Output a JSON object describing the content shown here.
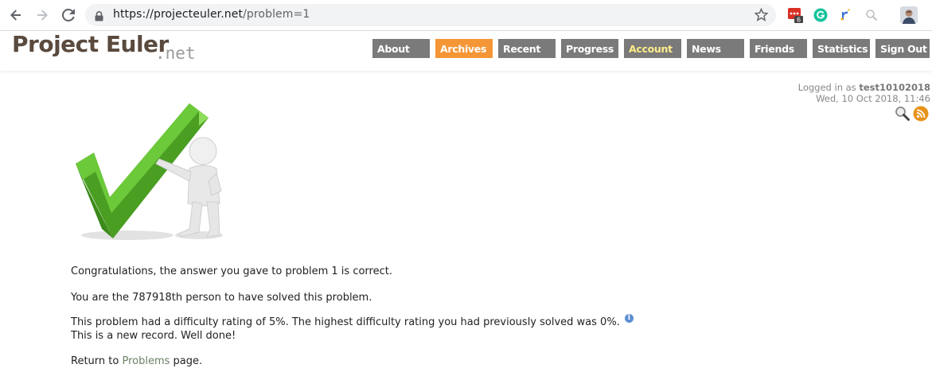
{
  "browser": {
    "url_host": "https://projecteuler.net",
    "url_path": "/problem=1",
    "ext_badge": "6"
  },
  "site": {
    "logo_main": "Project Euler",
    "logo_net": ".net",
    "menu": [
      {
        "label": "About"
      },
      {
        "label": "Archives"
      },
      {
        "label": "Recent"
      },
      {
        "label": "Progress"
      },
      {
        "label": "Account"
      },
      {
        "label": "News"
      },
      {
        "label": "Friends"
      },
      {
        "label": "Statistics"
      },
      {
        "label": "Sign Out"
      }
    ],
    "colors": {
      "active": "#f59636",
      "menu": "#7a7a7a",
      "account_text": "#ffed8a"
    }
  },
  "login": {
    "prefix": "Logged in as ",
    "username": "test10102018",
    "datetime": "Wed, 10 Oct 2018, 11:46"
  },
  "content": {
    "congrats": "Congratulations, the answer you gave to problem 1 is correct.",
    "solved_count": "You are the 787918th person to have solved this problem.",
    "difficulty": "This problem had a difficulty rating of 5%. The highest difficulty rating you had previously solved was 0%.",
    "record": "This is a new record. Well done!",
    "return_prefix": "Return to ",
    "return_link": "Problems",
    "return_suffix": " page."
  }
}
